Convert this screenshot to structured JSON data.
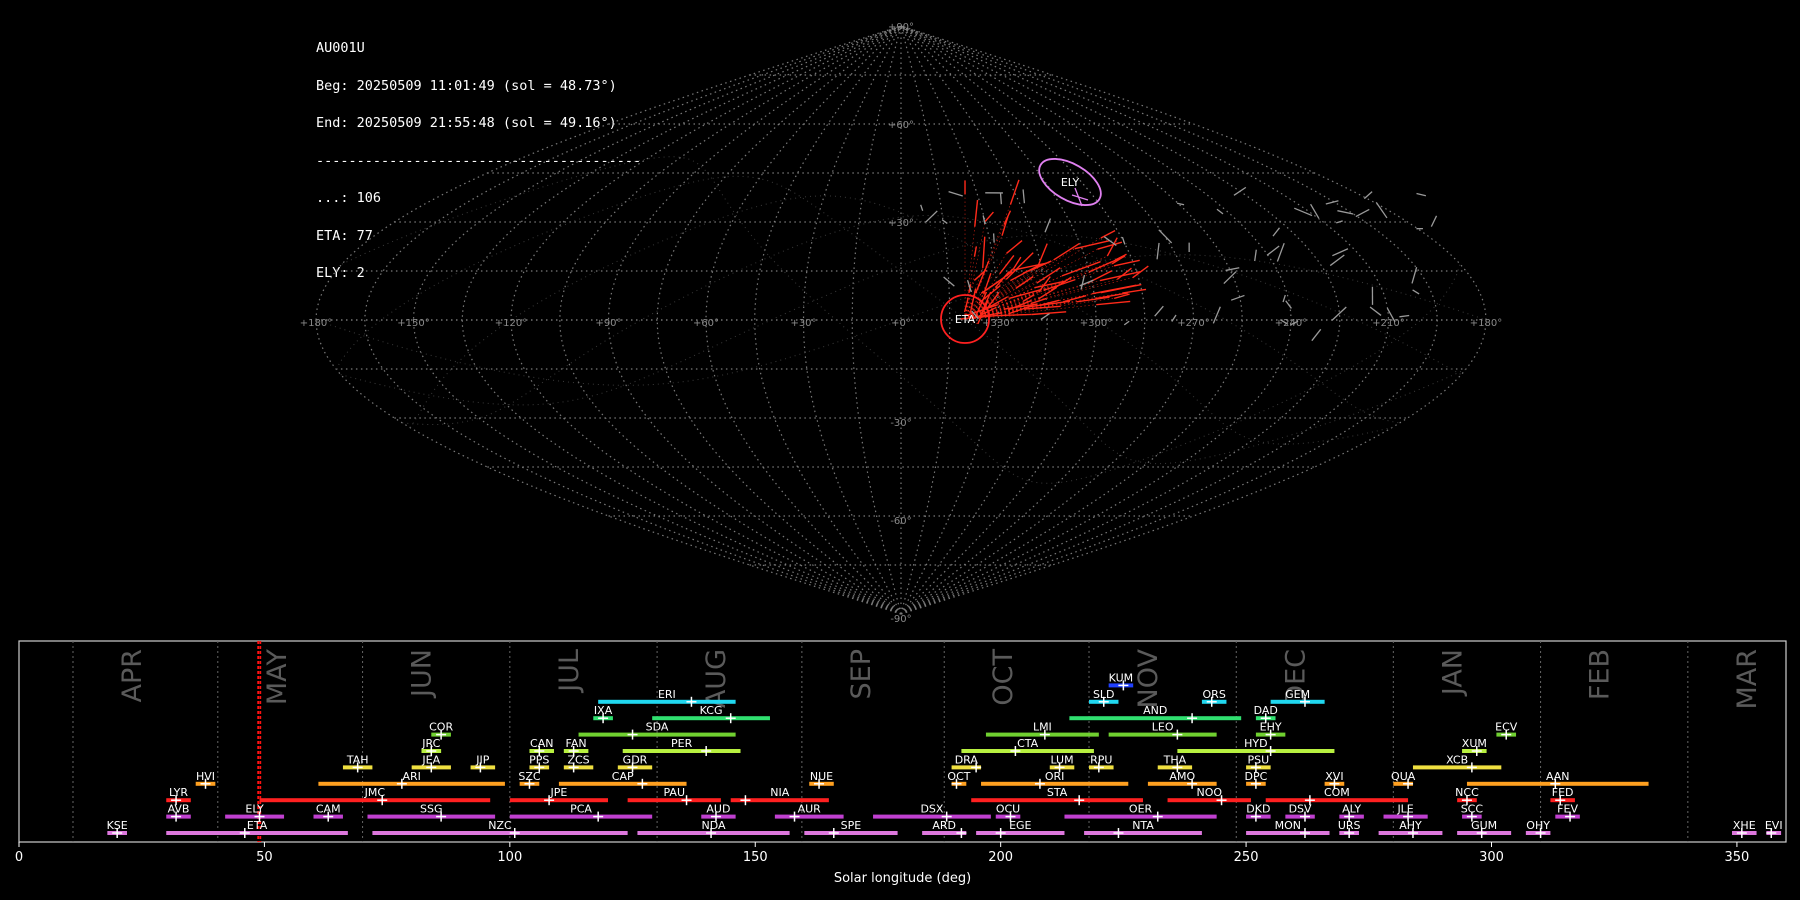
{
  "info": {
    "station": "AU001U",
    "begin": "Beg: 20250509 11:01:49 (sol = 48.73°)",
    "end": "End: 20250509 21:55:48 (sol = 49.16°)",
    "separator": "----------------------------------------",
    "counts": [
      "...: 106",
      "ETA: 77",
      "ELY: 2"
    ]
  },
  "chart_data": [
    {
      "type": "scatter",
      "projection": "sinusoidal",
      "title": "",
      "lon_tick_labels": [
        "+180°",
        "+150°",
        "+120°",
        "+90°",
        "+60°",
        "+30°",
        "+0°",
        "+330°",
        "+300°",
        "+270°",
        "+240°",
        "+210°",
        "+180°"
      ],
      "lat_tick_labels": [
        "+90°",
        "+60°",
        "+30°",
        "-30°",
        "-60°",
        "-90°"
      ],
      "showers": [
        {
          "code": "ETA",
          "color": "#ff2020"
        },
        {
          "code": "ELY",
          "color": "#e080f0"
        }
      ],
      "colors": {
        "grid": "#7a7a7a",
        "eta": "#ff2a1a",
        "ely": "#e080f0",
        "sporadic": "#9a9a9a"
      }
    },
    {
      "type": "bar",
      "title": "",
      "xlabel": "Solar longitude (deg)",
      "ylabel": "",
      "xlim": [
        0,
        360
      ],
      "x_ticks": [
        "0",
        "50",
        "100",
        "150",
        "200",
        "250",
        "300",
        "350"
      ],
      "months": [
        "APR",
        "MAY",
        "JUN",
        "JUL",
        "AUG",
        "SEP",
        "OCT",
        "NOV",
        "DEC",
        "JAN",
        "FEB",
        "MAR"
      ],
      "current_sol": [
        48.73,
        49.16
      ],
      "showers": [
        {
          "code": "KSE",
          "start": 18,
          "end": 22,
          "peak": 20,
          "row": 0,
          "color": "#dd77dd"
        },
        {
          "code": "ETA",
          "start": 30,
          "end": 67,
          "peak": 46,
          "row": 0,
          "color": "#dd77dd"
        },
        {
          "code": "NZC",
          "start": 72,
          "end": 124,
          "peak": 101,
          "row": 0,
          "color": "#dd77dd"
        },
        {
          "code": "NDA",
          "start": 126,
          "end": 157,
          "peak": 141,
          "row": 0,
          "color": "#dd77dd"
        },
        {
          "code": "SPE",
          "start": 160,
          "end": 179,
          "peak": 166,
          "row": 0,
          "color": "#dd77dd"
        },
        {
          "code": "ARD",
          "start": 184,
          "end": 193,
          "peak": 192,
          "row": 0,
          "color": "#dd77dd"
        },
        {
          "code": "EGE",
          "start": 195,
          "end": 213,
          "peak": 200,
          "row": 0,
          "color": "#dd77dd"
        },
        {
          "code": "NTA",
          "start": 217,
          "end": 241,
          "peak": 224,
          "row": 0,
          "color": "#dd77dd"
        },
        {
          "code": "MON",
          "start": 250,
          "end": 267,
          "peak": 262,
          "row": 0,
          "color": "#dd77dd"
        },
        {
          "code": "URS",
          "start": 269,
          "end": 273,
          "peak": 271,
          "row": 0,
          "color": "#dd77dd"
        },
        {
          "code": "AHY",
          "start": 277,
          "end": 290,
          "peak": 284,
          "row": 0,
          "color": "#dd77dd"
        },
        {
          "code": "GUM",
          "start": 293,
          "end": 304,
          "peak": 298,
          "row": 0,
          "color": "#dd77dd"
        },
        {
          "code": "OHY",
          "start": 307,
          "end": 312,
          "peak": 310,
          "row": 0,
          "color": "#dd77dd"
        },
        {
          "code": "XHE",
          "start": 349,
          "end": 354,
          "peak": 351,
          "row": 0,
          "color": "#dd77dd"
        },
        {
          "code": "EVI",
          "start": 356,
          "end": 359,
          "peak": 357,
          "row": 0,
          "color": "#dd77dd"
        },
        {
          "code": "AVB",
          "start": 30,
          "end": 35,
          "peak": 32,
          "row": 1,
          "color": "#c040d0"
        },
        {
          "code": "ELY",
          "start": 42,
          "end": 54,
          "peak": 49,
          "row": 1,
          "color": "#c040d0"
        },
        {
          "code": "CAM",
          "start": 60,
          "end": 66,
          "peak": 63,
          "row": 1,
          "color": "#c040d0"
        },
        {
          "code": "SSG",
          "start": 71,
          "end": 97,
          "peak": 86,
          "row": 1,
          "color": "#c040d0"
        },
        {
          "code": "PCA",
          "start": 100,
          "end": 129,
          "peak": 118,
          "row": 1,
          "color": "#c040d0"
        },
        {
          "code": "AUD",
          "start": 139,
          "end": 146,
          "peak": 142,
          "row": 1,
          "color": "#c040d0"
        },
        {
          "code": "AUR",
          "start": 154,
          "end": 168,
          "peak": 158,
          "row": 1,
          "color": "#c040d0"
        },
        {
          "code": "DSX",
          "start": 174,
          "end": 198,
          "peak": 189,
          "row": 1,
          "color": "#c040d0"
        },
        {
          "code": "OCU",
          "start": 199,
          "end": 204,
          "peak": 202,
          "row": 1,
          "color": "#c040d0"
        },
        {
          "code": "OER",
          "start": 213,
          "end": 244,
          "peak": 232,
          "row": 1,
          "color": "#c040d0"
        },
        {
          "code": "DKD",
          "start": 250,
          "end": 255,
          "peak": 252,
          "row": 1,
          "color": "#c040d0"
        },
        {
          "code": "DSV",
          "start": 258,
          "end": 264,
          "peak": 262,
          "row": 1,
          "color": "#c040d0"
        },
        {
          "code": "ALY",
          "start": 269,
          "end": 274,
          "peak": 271,
          "row": 1,
          "color": "#c040d0"
        },
        {
          "code": "JLE",
          "start": 278,
          "end": 287,
          "peak": 283,
          "row": 1,
          "color": "#c040d0"
        },
        {
          "code": "SCC",
          "start": 294,
          "end": 298,
          "peak": 296,
          "row": 1,
          "color": "#c040d0"
        },
        {
          "code": "FEV",
          "start": 313,
          "end": 318,
          "peak": 316,
          "row": 1,
          "color": "#c040d0"
        },
        {
          "code": "LYR",
          "start": 30,
          "end": 35,
          "peak": 32,
          "row": 2,
          "color": "#ff2020"
        },
        {
          "code": "JMC",
          "start": 49,
          "end": 96,
          "peak": 74,
          "row": 2,
          "color": "#ff2020"
        },
        {
          "code": "JPE",
          "start": 100,
          "end": 120,
          "peak": 108,
          "row": 2,
          "color": "#ff2020"
        },
        {
          "code": "PAU",
          "start": 124,
          "end": 143,
          "peak": 136,
          "row": 2,
          "color": "#ff2020"
        },
        {
          "code": "NIA",
          "start": 145,
          "end": 165,
          "peak": 148,
          "row": 2,
          "color": "#ff2020"
        },
        {
          "code": "STA",
          "start": 194,
          "end": 229,
          "peak": 216,
          "row": 2,
          "color": "#ff2020"
        },
        {
          "code": "NOO",
          "start": 234,
          "end": 251,
          "peak": 245,
          "row": 2,
          "color": "#ff2020"
        },
        {
          "code": "COM",
          "start": 254,
          "end": 283,
          "peak": 263,
          "row": 2,
          "color": "#ff2020"
        },
        {
          "code": "NCC",
          "start": 293,
          "end": 297,
          "peak": 295,
          "row": 2,
          "color": "#ff2020"
        },
        {
          "code": "FED",
          "start": 312,
          "end": 317,
          "peak": 314,
          "row": 2,
          "color": "#ff2020"
        },
        {
          "code": "HVI",
          "start": 36,
          "end": 40,
          "peak": 38,
          "row": 3,
          "color": "#ffa020"
        },
        {
          "code": "ARI",
          "start": 61,
          "end": 99,
          "peak": 78,
          "row": 3,
          "color": "#ffa020"
        },
        {
          "code": "SZC",
          "start": 102,
          "end": 106,
          "peak": 104,
          "row": 3,
          "color": "#ffa020"
        },
        {
          "code": "CAP",
          "start": 110,
          "end": 136,
          "peak": 127,
          "row": 3,
          "color": "#ffa020"
        },
        {
          "code": "NUE",
          "start": 161,
          "end": 166,
          "peak": 163,
          "row": 3,
          "color": "#ffa020"
        },
        {
          "code": "OCT",
          "start": 190,
          "end": 193,
          "peak": 191,
          "row": 3,
          "color": "#ffa020"
        },
        {
          "code": "ORI",
          "start": 196,
          "end": 226,
          "peak": 208,
          "row": 3,
          "color": "#ffa020"
        },
        {
          "code": "AMO",
          "start": 230,
          "end": 244,
          "peak": 239,
          "row": 3,
          "color": "#ffa020"
        },
        {
          "code": "DPC",
          "start": 250,
          "end": 254,
          "peak": 252,
          "row": 3,
          "color": "#ffa020"
        },
        {
          "code": "XVI",
          "start": 266,
          "end": 270,
          "peak": 268,
          "row": 3,
          "color": "#ffa020"
        },
        {
          "code": "QUA",
          "start": 280,
          "end": 284,
          "peak": 283,
          "row": 3,
          "color": "#ffa020"
        },
        {
          "code": "AAN",
          "start": 295,
          "end": 332,
          "peak": 313,
          "row": 3,
          "color": "#ffa020"
        },
        {
          "code": "TAH",
          "start": 66,
          "end": 72,
          "peak": 69,
          "row": 4,
          "color": "#f0e040"
        },
        {
          "code": "JEA",
          "start": 80,
          "end": 88,
          "peak": 84,
          "row": 4,
          "color": "#f0e040"
        },
        {
          "code": "JIP",
          "start": 92,
          "end": 97,
          "peak": 94,
          "row": 4,
          "color": "#f0e040"
        },
        {
          "code": "PPS",
          "start": 104,
          "end": 108,
          "peak": 106,
          "row": 4,
          "color": "#f0e040"
        },
        {
          "code": "ZCS",
          "start": 111,
          "end": 117,
          "peak": 113,
          "row": 4,
          "color": "#f0e040"
        },
        {
          "code": "GDR",
          "start": 122,
          "end": 129,
          "peak": 125,
          "row": 4,
          "color": "#f0e040"
        },
        {
          "code": "DRA",
          "start": 190,
          "end": 196,
          "peak": 195,
          "row": 4,
          "color": "#f0e040"
        },
        {
          "code": "LUM",
          "start": 210,
          "end": 215,
          "peak": 212,
          "row": 4,
          "color": "#f0e040"
        },
        {
          "code": "RPU",
          "start": 218,
          "end": 223,
          "peak": 220,
          "row": 4,
          "color": "#f0e040"
        },
        {
          "code": "THA",
          "start": 232,
          "end": 239,
          "peak": 236,
          "row": 4,
          "color": "#f0e040"
        },
        {
          "code": "PSU",
          "start": 250,
          "end": 255,
          "peak": 252,
          "row": 4,
          "color": "#f0e040"
        },
        {
          "code": "XCB",
          "start": 284,
          "end": 302,
          "peak": 296,
          "row": 4,
          "color": "#f0e040"
        },
        {
          "code": "JRC",
          "start": 82,
          "end": 86,
          "peak": 84,
          "row": 5,
          "color": "#b8f040"
        },
        {
          "code": "CAN",
          "start": 104,
          "end": 109,
          "peak": 106,
          "row": 5,
          "color": "#b8f040"
        },
        {
          "code": "FAN",
          "start": 111,
          "end": 116,
          "peak": 113,
          "row": 5,
          "color": "#b8f040"
        },
        {
          "code": "PER",
          "start": 123,
          "end": 147,
          "peak": 140,
          "row": 5,
          "color": "#b8f040"
        },
        {
          "code": "CTA",
          "start": 192,
          "end": 219,
          "peak": 203,
          "row": 5,
          "color": "#b8f040"
        },
        {
          "code": "HYD",
          "start": 236,
          "end": 268,
          "peak": 255,
          "row": 5,
          "color": "#b8f040"
        },
        {
          "code": "XUM",
          "start": 294,
          "end": 299,
          "peak": 297,
          "row": 5,
          "color": "#b8f040"
        },
        {
          "code": "COR",
          "start": 84,
          "end": 88,
          "peak": 86,
          "row": 6,
          "color": "#70d030"
        },
        {
          "code": "SDA",
          "start": 114,
          "end": 146,
          "peak": 125,
          "row": 6,
          "color": "#70d030"
        },
        {
          "code": "LMI",
          "start": 197,
          "end": 220,
          "peak": 209,
          "row": 6,
          "color": "#70d030"
        },
        {
          "code": "LEO",
          "start": 222,
          "end": 244,
          "peak": 236,
          "row": 6,
          "color": "#70d030"
        },
        {
          "code": "EHY",
          "start": 252,
          "end": 258,
          "peak": 255,
          "row": 6,
          "color": "#70d030"
        },
        {
          "code": "ECV",
          "start": 301,
          "end": 305,
          "peak": 303,
          "row": 6,
          "color": "#70d030"
        },
        {
          "code": "IXA",
          "start": 117,
          "end": 121,
          "peak": 119,
          "row": 7,
          "color": "#30e070"
        },
        {
          "code": "KCG",
          "start": 129,
          "end": 153,
          "peak": 145,
          "row": 7,
          "color": "#30e070"
        },
        {
          "code": "AND",
          "start": 214,
          "end": 249,
          "peak": 239,
          "row": 7,
          "color": "#30e070"
        },
        {
          "code": "DAD",
          "start": 252,
          "end": 256,
          "peak": 254,
          "row": 7,
          "color": "#30e070"
        },
        {
          "code": "ERI",
          "start": 118,
          "end": 146,
          "peak": 137,
          "row": 8,
          "color": "#20d8f0"
        },
        {
          "code": "SLD",
          "start": 218,
          "end": 224,
          "peak": 221,
          "row": 8,
          "color": "#20d8f0"
        },
        {
          "code": "ORS",
          "start": 241,
          "end": 246,
          "peak": 243,
          "row": 8,
          "color": "#20d8f0"
        },
        {
          "code": "GEM",
          "start": 255,
          "end": 266,
          "peak": 262,
          "row": 8,
          "color": "#20d8f0"
        },
        {
          "code": "KUM",
          "start": 222,
          "end": 227,
          "peak": 225,
          "row": 9,
          "color": "#2040ff"
        }
      ]
    }
  ]
}
